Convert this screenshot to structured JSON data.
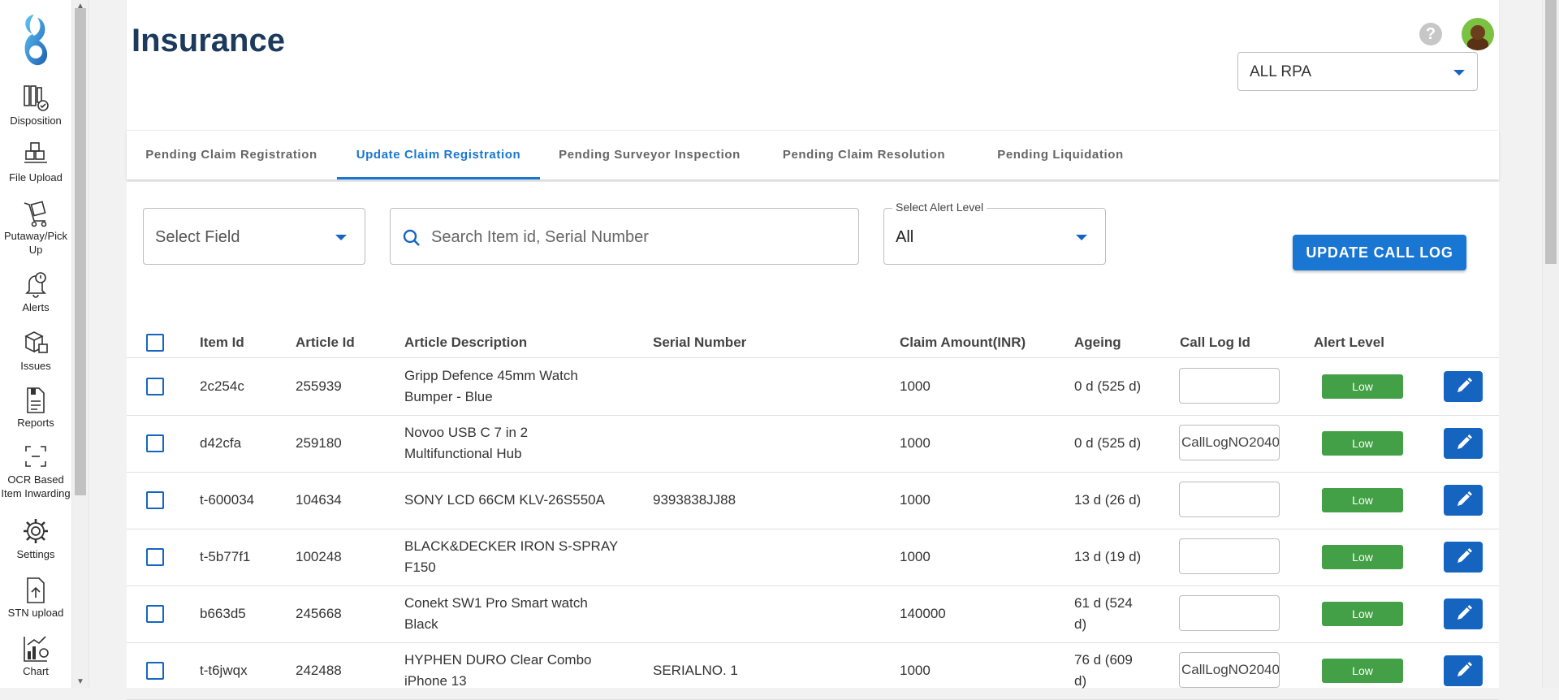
{
  "sidebar": {
    "items": [
      {
        "label": "Disposition",
        "icon": "books-check-icon"
      },
      {
        "label": "File Upload",
        "icon": "boxes-upload-icon"
      },
      {
        "label": "Putaway/Pick Up",
        "icon": "cart-icon"
      },
      {
        "label": "Alerts",
        "icon": "bell-icon"
      },
      {
        "label": "Issues",
        "icon": "cubes-icon"
      },
      {
        "label": "Reports",
        "icon": "report-icon"
      },
      {
        "label": "OCR Based Item Inwarding",
        "icon": "scan-frame-icon"
      },
      {
        "label": "Settings",
        "icon": "gear-icon"
      },
      {
        "label": "STN upload",
        "icon": "document-upload-icon"
      },
      {
        "label": "Chart",
        "icon": "chart-icon"
      }
    ]
  },
  "header": {
    "title": "Insurance",
    "help_glyph": "?",
    "rpa_select": "ALL RPA"
  },
  "tabs": [
    {
      "label": "Pending Claim Registration"
    },
    {
      "label": "Update Claim Registration"
    },
    {
      "label": "Pending Surveyor Inspection"
    },
    {
      "label": "Pending Claim Resolution"
    },
    {
      "label": "Pending Liquidation"
    }
  ],
  "active_tab": 1,
  "filters": {
    "select_field": "Select Field",
    "search_placeholder": "Search Item id, Serial Number",
    "alert_level_legend": "Select Alert Level",
    "alert_level_value": "All",
    "update_button": "UPDATE CALL LOG"
  },
  "table": {
    "headers": {
      "item_id": "Item Id",
      "article_id": "Article Id",
      "description": "Article Description",
      "serial": "Serial Number",
      "claim": "Claim Amount(INR)",
      "ageing": "Ageing",
      "call_log": "Call Log Id",
      "alert": "Alert Level"
    },
    "rows": [
      {
        "item_id": "2c254c",
        "article_id": "255939",
        "desc1": "Gripp Defence 45mm Watch",
        "desc2": "Bumper - Blue",
        "serial": "",
        "claim": "1000",
        "age1": "0 d (525 d)",
        "age2": "",
        "call_log": "",
        "alert": "Low"
      },
      {
        "item_id": "d42cfa",
        "article_id": "259180",
        "desc1": "Novoo USB C 7 in 2",
        "desc2": "Multifunctional Hub",
        "serial": "",
        "claim": "1000",
        "age1": "0 d (525 d)",
        "age2": "",
        "call_log": "CallLogNO2040",
        "alert": "Low"
      },
      {
        "item_id": "t-600034",
        "article_id": "104634",
        "desc1": "SONY LCD 66CM KLV-26S550A",
        "desc2": "",
        "serial": "9393838JJ88",
        "claim": "1000",
        "age1": "13 d (26 d)",
        "age2": "",
        "call_log": "",
        "alert": "Low"
      },
      {
        "item_id": "t-5b77f1",
        "article_id": "100248",
        "desc1": "BLACK&DECKER IRON S-SPRAY",
        "desc2": "F150",
        "serial": "",
        "claim": "1000",
        "age1": "13 d (19 d)",
        "age2": "",
        "call_log": "",
        "alert": "Low"
      },
      {
        "item_id": "b663d5",
        "article_id": "245668",
        "desc1": "Conekt SW1 Pro Smart watch",
        "desc2": "Black",
        "serial": "",
        "claim": "140000",
        "age1": "61 d (524",
        "age2": "d)",
        "call_log": "",
        "alert": "Low"
      },
      {
        "item_id": "t-t6jwqx",
        "article_id": "242488",
        "desc1": "HYPHEN DURO Clear Combo",
        "desc2": "iPhone 13",
        "serial": "SERIALNO. 1",
        "claim": "1000",
        "age1": "76 d (609",
        "age2": "d)",
        "call_log": "CallLogNO2040",
        "alert": "Low"
      }
    ]
  },
  "colors": {
    "primary": "#1976d2",
    "badge_low": "#43a047",
    "title": "#1b3a5c",
    "edit_button": "#1565c0"
  }
}
